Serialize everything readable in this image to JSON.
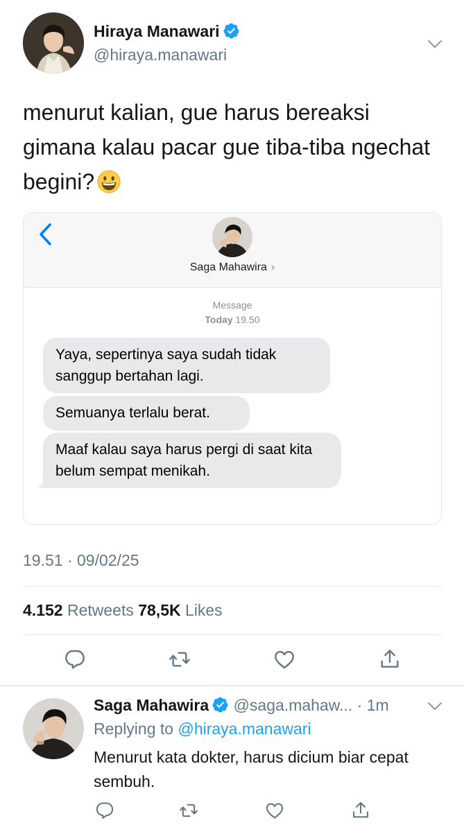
{
  "main_tweet": {
    "author_name": "Hiraya Manawari",
    "author_handle": "@hiraya.manawari",
    "text": "menurut kalian, gue harus bereaksi gimana kalau pacar gue tiba-tiba ngechat begini?",
    "emoji": "grinning-face",
    "timestamp": "19.51 · 09/02/25",
    "retweet_count": "4.152",
    "retweet_label": "Retweets",
    "like_count": "78,5K",
    "like_label": "Likes"
  },
  "embedded_chat": {
    "contact_name": "Saga Mahawira",
    "contact_chevron": "›",
    "service_label": "Message",
    "day_label": "Today",
    "time_label": "19.50",
    "messages": [
      "Yaya, sepertinya saya sudah tidak sanggup bertahan lagi.",
      "Semuanya terlalu berat.",
      "Maaf kalau saya harus pergi di saat kita belum sempat menikah."
    ]
  },
  "reply_tweet": {
    "author_name": "Saga Mahawira",
    "author_handle": "@saga.mahaw...",
    "separator": " · ",
    "age": "1m",
    "replying_prefix": "Replying to",
    "replying_user": "@hiraya.manawari",
    "text": "Menurut kata dokter, harus dicium biar cepat sembuh."
  },
  "colors": {
    "verified": "#1da1f2",
    "link": "#1da1f2",
    "ios_blue": "#007aff",
    "muted": "#657786",
    "bubble": "#e9e9eb"
  },
  "icons": [
    "verified-badge-icon",
    "chevron-down-icon",
    "back-chevron-icon",
    "reply-icon",
    "retweet-icon",
    "like-icon",
    "share-icon"
  ]
}
